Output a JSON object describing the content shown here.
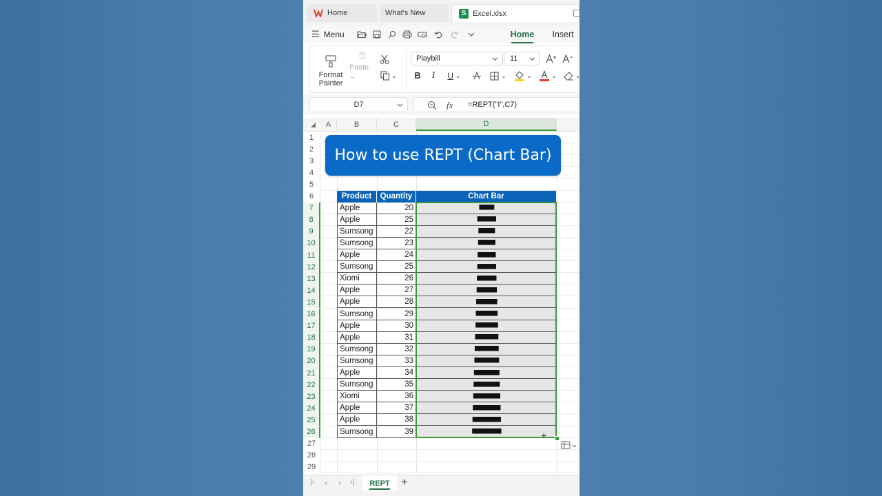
{
  "tabs": [
    {
      "label": "Home",
      "icon": "wps-logo-icon"
    },
    {
      "label": "What's New",
      "icon": ""
    },
    {
      "label": "Excel.xlsx",
      "icon": "spreadsheet-icon",
      "icon_letter": "S"
    }
  ],
  "menu": {
    "menu_label": "Menu",
    "ribbon_tabs": [
      {
        "label": "Home",
        "active": true
      },
      {
        "label": "Insert",
        "active": false
      }
    ]
  },
  "ribbon": {
    "format_painter_line1": "Format",
    "format_painter_line2": "Painter",
    "paste_label": "Paste",
    "font_name": "Playbill",
    "font_size": "11",
    "bold": "B",
    "italic": "I",
    "underline": "U"
  },
  "formula_bar": {
    "name_box": "D7",
    "fx": "fx",
    "formula": "=REPT(\"I\",C7)"
  },
  "grid": {
    "column_headers": [
      "A",
      "B",
      "C",
      "D"
    ],
    "row_numbers": [
      "1",
      "2",
      "3",
      "4",
      "5",
      "6",
      "7",
      "8",
      "9",
      "10",
      "11",
      "12",
      "13",
      "14",
      "15",
      "16",
      "17",
      "18",
      "19",
      "20",
      "21",
      "22",
      "23",
      "24",
      "25",
      "26",
      "27",
      "28",
      "29"
    ],
    "banner_title": "How to use REPT (Chart Bar)",
    "table_headers": [
      "Product",
      "Quantity",
      "Chart Bar"
    ],
    "rows": [
      {
        "product": "Apple",
        "quantity": 20
      },
      {
        "product": "Apple",
        "quantity": 25
      },
      {
        "product": "Sumsong",
        "quantity": 22
      },
      {
        "product": "Sumsong",
        "quantity": 23
      },
      {
        "product": "Apple",
        "quantity": 24
      },
      {
        "product": "Sumsong",
        "quantity": 25
      },
      {
        "product": "Xiomi",
        "quantity": 26
      },
      {
        "product": "Apple",
        "quantity": 27
      },
      {
        "product": "Apple",
        "quantity": 28
      },
      {
        "product": "Sumsong",
        "quantity": 29
      },
      {
        "product": "Apple",
        "quantity": 30
      },
      {
        "product": "Apple",
        "quantity": 31
      },
      {
        "product": "Sumsong",
        "quantity": 32
      },
      {
        "product": "Sumsong",
        "quantity": 33
      },
      {
        "product": "Apple",
        "quantity": 34
      },
      {
        "product": "Sumsong",
        "quantity": 35
      },
      {
        "product": "Xiomi",
        "quantity": 36
      },
      {
        "product": "Apple",
        "quantity": 37
      },
      {
        "product": "Apple",
        "quantity": 38
      },
      {
        "product": "Sumsong",
        "quantity": 39
      }
    ]
  },
  "sheet_tabs": [
    {
      "label": "REPT",
      "active": true
    }
  ],
  "colors": {
    "accent_green": "#1e7145",
    "header_blue": "#0b63b8",
    "banner_blue": "#0a6ac7",
    "selection_green": "#3c9a3c",
    "wps_red": "#e03b2f",
    "font_color_red": "#e53935",
    "highlight_yellow": "#f5d21c"
  }
}
